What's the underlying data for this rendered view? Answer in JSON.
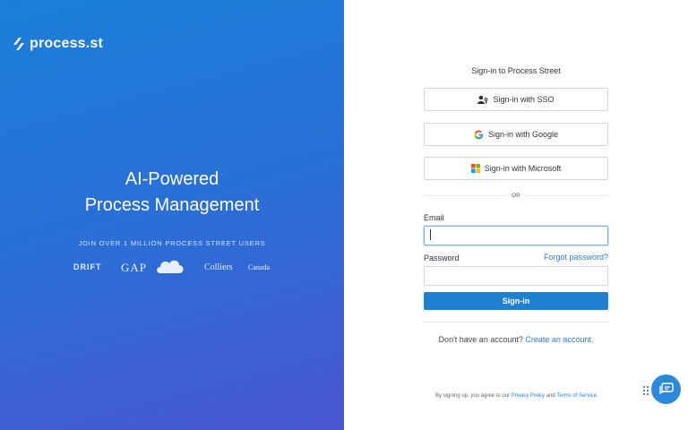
{
  "brand": {
    "logo_text": "process.st",
    "logo_icon": "process-street-logo-icon"
  },
  "hero": {
    "line1": "AI-Powered",
    "line2": "Process Management"
  },
  "join_text": "JOIN OVER 1 MILLION PROCESS STREET USERS",
  "customer_logos": [
    "DRIFT",
    "GAP",
    "salesforce",
    "Colliers",
    "Canada"
  ],
  "form": {
    "title": "Sign-in to Process Street",
    "sso_label": "Sign-in with SSO",
    "google_label": "Sign-in with Google",
    "microsoft_label": "Sign-in with Microsoft",
    "or_text": "OR",
    "email_label": "Email",
    "email_value": "",
    "password_label": "Password",
    "password_value": "",
    "forgot_label": "Forgot password?",
    "submit_label": "Sign-in",
    "no_account_text": "Don't have an account?",
    "create_account_label": "Create an account.",
    "terms_prefix": "By signing up, you agree to our",
    "privacy_label": "Privacy Policy",
    "terms_and": "and",
    "terms_label": "Terms of Service"
  },
  "colors": {
    "primary": "#1f7fd0",
    "gradient_start": "#1a7fd9",
    "gradient_end": "#4a55d2",
    "link": "#2b7dd0"
  },
  "icons": {
    "sso": "user-key-icon",
    "google": "google-icon",
    "microsoft": "microsoft-icon",
    "chat": "chat-bubble-icon",
    "drag": "drag-handle-icon"
  }
}
